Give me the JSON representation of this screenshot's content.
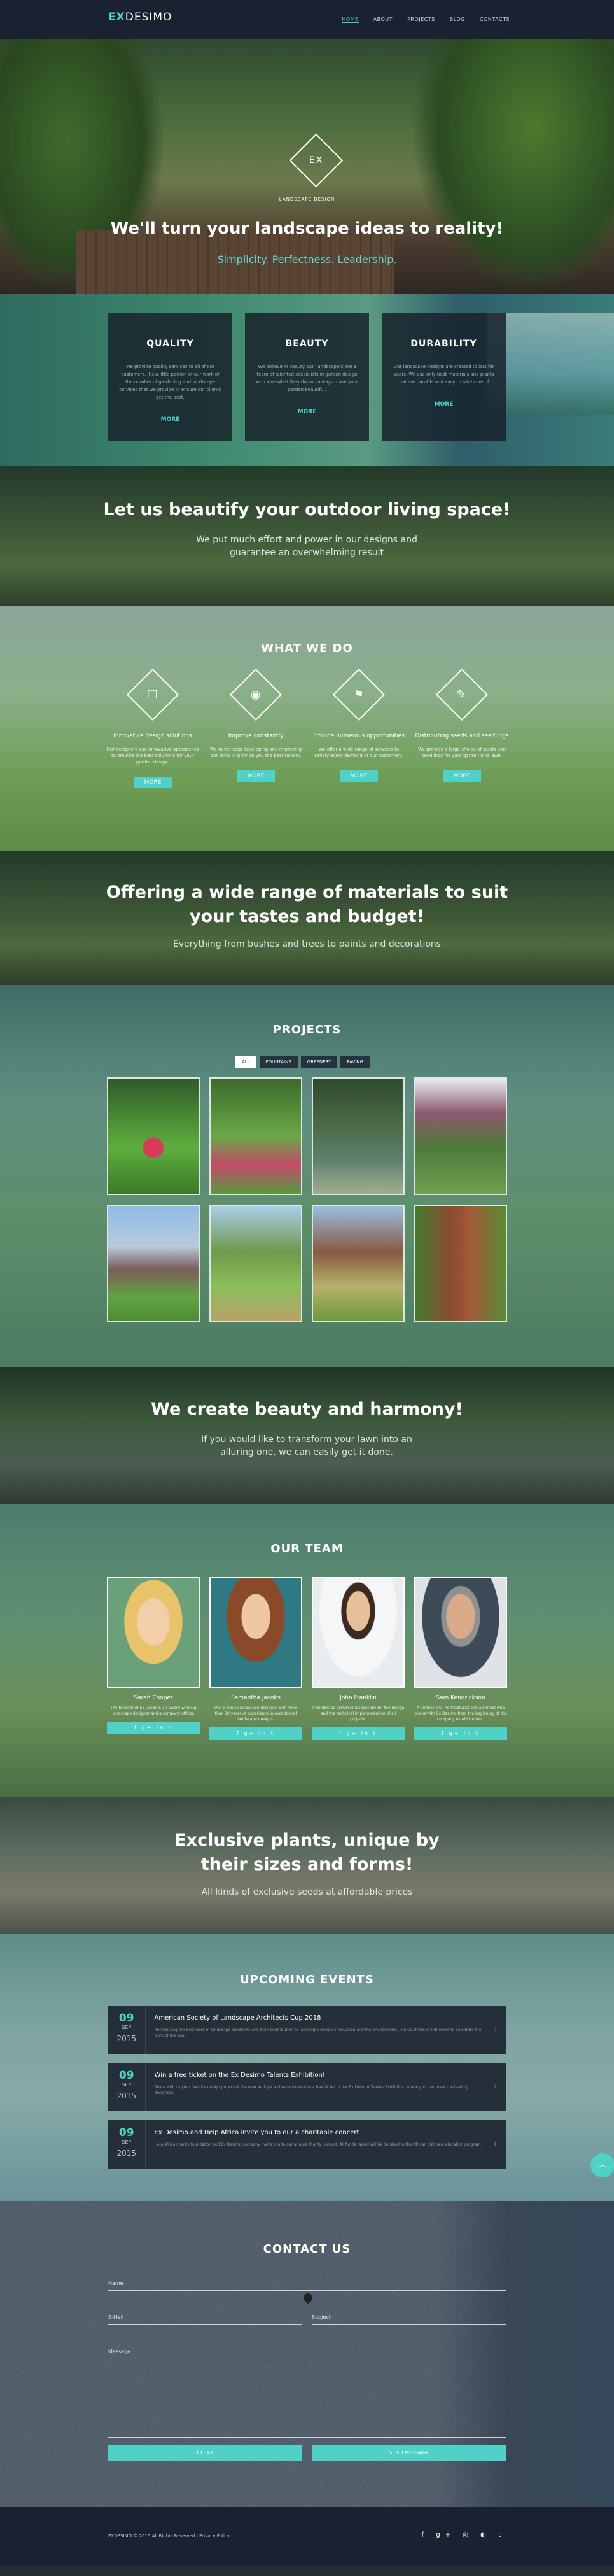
{
  "nav": {
    "logo_a": "EX",
    "logo_b": "DESIMO",
    "items": [
      "HOME",
      "ABOUT",
      "PROJECTS",
      "BLOG",
      "CONTACTS"
    ]
  },
  "hero": {
    "emblem": "EX",
    "tagline": "LANDSCAPE DESIGN",
    "title": "We'll turn your landscape ideas to reality!",
    "subtitle": "Simplicity. Perfectness. Leadership."
  },
  "features": [
    {
      "title": "QUALITY",
      "desc": "We provide quality services to all of our customers. It's a little portion of our work of the number of gardening and landscape services that we provide to ensure our clients get the best.",
      "more": "MORE"
    },
    {
      "title": "BEAUTY",
      "desc": "We believe in beauty. Our landscapers are a team of talented specialists in garden design who love what they do and always make your garden beautiful.",
      "more": "MORE"
    },
    {
      "title": "DURABILITY",
      "desc": "Our landscape designs are created to last for years. We use only best materials and plants that are durable and easy to take care of.",
      "more": "MORE"
    }
  ],
  "band1": {
    "title": "Let us beautify your outdoor living space!",
    "text": "We put much effort and power in our designs and guarantee an overwhelming result"
  },
  "what": {
    "title": "WHAT WE DO",
    "items": [
      {
        "title": "Innovative design solutions",
        "desc": "Our designers use innovative approaches to provide the best solutions for your garden design.",
        "btn": "MORE",
        "icon": "cube-icon"
      },
      {
        "title": "Improve constantly",
        "desc": "We never stop developing and improving our skills to provide you the best results.",
        "btn": "MORE",
        "icon": "eye-icon"
      },
      {
        "title": "Provide numerous opportunities",
        "desc": "We offer a wide range of services to satisfy every demand of our customers.",
        "btn": "MORE",
        "icon": "flag-icon"
      },
      {
        "title": "Distributing seeds and seedlings",
        "desc": "We provide a large choice of seeds and seedlings for your garden and lawn.",
        "btn": "MORE",
        "icon": "pencil-icon"
      }
    ]
  },
  "band2": {
    "title": "Offering a wide range of materials to suit your tastes and budget!",
    "text": "Everything from bushes and trees to paints and decorations"
  },
  "projects": {
    "title": "PROJECTS",
    "filters": [
      "ALL",
      "FOUNTAINS",
      "GREENERY",
      "PAVING"
    ]
  },
  "band3": {
    "title": "We create beauty and harmony!",
    "text": "If you would like to transform your lawn into an alluring one, we can easily get it done."
  },
  "team": {
    "title": "OUR TEAM",
    "members": [
      {
        "name": "Sarah Cooper",
        "desc": "The founder of Ex Desimo, an award-winning landscape designer and a company officer."
      },
      {
        "name": "Samantha Jacobs",
        "desc": "Our in-house landscape designer with more than 10 years of experience in exceptional landscape designs."
      },
      {
        "name": "John Franklin",
        "desc": "A landscape architect responsible for the design and the technical implementation of all projects."
      },
      {
        "name": "Sam Kendrickson",
        "desc": "A professional horticulturist and architect who works with Ex Desimo from the beginning of the company establishment."
      }
    ]
  },
  "band4": {
    "title": "Exclusive plants, unique by their sizes and forms!",
    "text": "All kinds of exclusive seeds at affordable prices"
  },
  "events": {
    "title": "UPCOMING EVENTS",
    "items": [
      {
        "day": "09",
        "month": "SEP",
        "year": "2015",
        "title": "American Society of Landscape Architects Cup 2018",
        "desc": "Recognizing the best work of landscape architects and their contribution to landscape design, innovation and the environment. Join us at this grand event to celebrate the work of the year."
      },
      {
        "day": "09",
        "month": "SEP",
        "year": "2015",
        "title": "Win a free ticket on the Ex Desimo Talents Exhibition!",
        "desc": "Share with us your favorite design project of the year and get a chance to receive a free ticket to our Ex Desimo Talents Exhibition, where you can meet the leading designers."
      },
      {
        "day": "09",
        "month": "SEP",
        "year": "2015",
        "title": "Ex Desimo and Help Africa invite you to our a charitable concert",
        "desc": "Help Africa charity foundation and Ex Desimo company invite you to our annual charity concert. All funds raised will be donated to the African children education program."
      }
    ]
  },
  "contact": {
    "title": "CONTACT US",
    "name": "Name",
    "email": "E-Mail",
    "subject": "Subject",
    "message": "Message",
    "clear": "CLEAR",
    "send": "SEND MESSAGE"
  },
  "footer": {
    "copy": "EXDESIMO © 2015 All Rights Reserved | Privacy Policy",
    "social": "f  g+  ◎  ◐  t"
  },
  "colors": {
    "accent": "#4fd1c8",
    "nav": "#1a2130",
    "box": "#252f3a"
  }
}
